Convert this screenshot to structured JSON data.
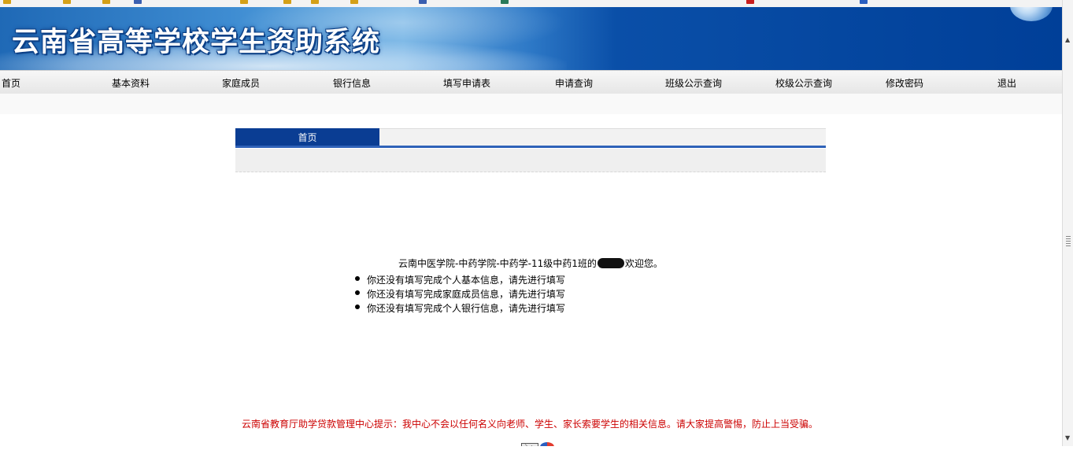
{
  "browser": {
    "favorites_bar": "favorites-toolbar",
    "scroll_icons": [
      "scroll-up-arrow",
      "scroll-down-arrow"
    ]
  },
  "header": {
    "title": "云南省高等学校学生资助系统"
  },
  "nav": {
    "items": [
      {
        "label": "首页"
      },
      {
        "label": "基本资料"
      },
      {
        "label": "家庭成员"
      },
      {
        "label": "银行信息"
      },
      {
        "label": "填写申请表"
      },
      {
        "label": "申请查询"
      },
      {
        "label": "班级公示查询"
      },
      {
        "label": "校级公示查询"
      },
      {
        "label": "修改密码"
      },
      {
        "label": "退出"
      }
    ]
  },
  "panel": {
    "active_tab": "首页"
  },
  "welcome": {
    "prefix": "云南中医学院-中药学院-中药学-11级中药1班的",
    "suffix": "欢迎您。"
  },
  "notices": [
    "你还没有填写完成个人基本信息，请先进行填写",
    "你还没有填写完成家庭成员信息，请先进行填写",
    "你还没有填写完成个人银行信息，请先进行填写"
  ],
  "footer": {
    "warning": "云南省教育厅助学贷款管理中心提示：我中心不会以任何名义向老师、学生、家长索要学生的相关信息。请大家提高警惕，防止上当受骗。",
    "icons": [
      "mail-icon",
      "ie-icon"
    ]
  },
  "colors": {
    "banner_blue": "#003f98",
    "tab_blue": "#0a3d93",
    "warning_red": "#cc0000"
  }
}
